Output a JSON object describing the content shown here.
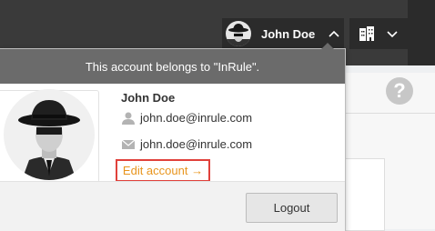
{
  "topbar": {
    "user_name": "John Doe",
    "user_chevron_icon": "chevron-up-icon",
    "tenant_icon": "building-icon",
    "tenant_chevron_icon": "chevron-down-icon"
  },
  "account_menu": {
    "header_text": "This account belongs to \"InRule\".",
    "user_name": "John Doe",
    "username_icon": "user-icon",
    "username_value": "john.doe@inrule.com",
    "email_icon": "envelope-icon",
    "email_value": "john.doe@inrule.com",
    "edit_account_label": "Edit account →",
    "logout_label": "Logout"
  },
  "background": {
    "help_icon": "question-icon",
    "help_glyph": "?"
  },
  "colors": {
    "topbar": "#3a3a3a",
    "button_dark": "#2b2b2b",
    "menu_header": "#6b6b6b",
    "link_orange": "#e8951e",
    "highlight_red": "#e0413b"
  }
}
